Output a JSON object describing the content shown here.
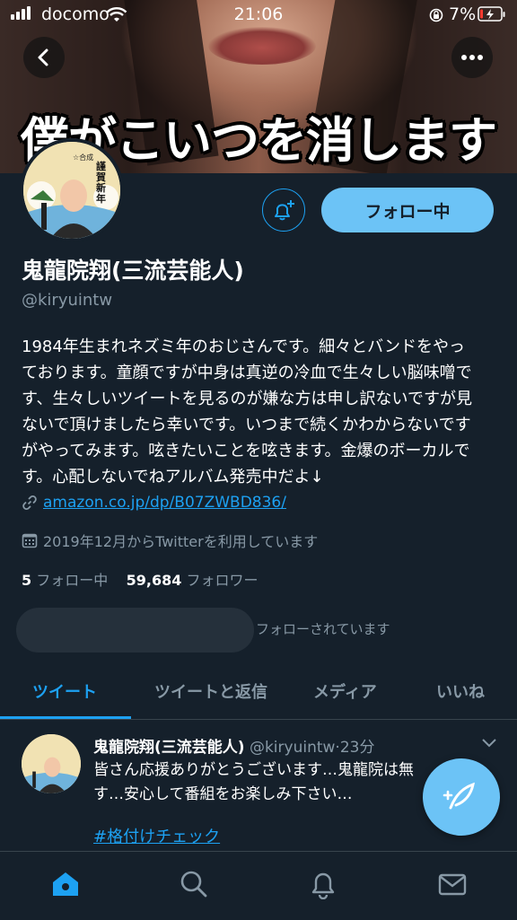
{
  "status_bar": {
    "carrier": "docomo",
    "time": "21:06",
    "battery": "7%"
  },
  "banner": {
    "caption": "僕がこいつを消します"
  },
  "avatar_badge": {
    "top": "☆合成",
    "main": "謹賀新年"
  },
  "profile": {
    "follow_button": "フォロー中",
    "display_name": "鬼龍院翔(三流芸能人)",
    "handle": "@kiryuintw",
    "bio": "1984年生まれネズミ年のおじさんです。細々とバンドをやっ\nております。童顔ですが中身は真逆の冷血で生々しい脳味噌で\nす、生々しいツイートを見るのが嫌な方は申し訳ないですが見\nないで頂けましたら幸いです。いつまで続くかわからないです\nがやってみます。呟きたいことを呟きます。金爆のボーカルで\nす。心配しないでねアルバム発売中だよ↓",
    "link": "amazon.co.jp/dp/B07ZWBD836/",
    "joined": "2019年12月からTwitterを利用しています",
    "following_count": "5",
    "following_label": "フォロー中",
    "followers_count": "59,684",
    "followers_label": "フォロワー",
    "followed_by": "フォローされています"
  },
  "tabs": [
    {
      "label": "ツイート",
      "active": true
    },
    {
      "label": "ツイートと返信",
      "active": false
    },
    {
      "label": "メディア",
      "active": false
    },
    {
      "label": "いいね",
      "active": false
    }
  ],
  "tweet": {
    "name": "鬼龍院翔(三流芸能人)",
    "handle": "@kiryuintw",
    "time": "23分",
    "text": "皆さん応援ありがとうございます…鬼龍院は無\nす…安心して番組をお楽しみ下さい…",
    "hashtag": "#格付けチェック"
  },
  "icons": {
    "back": "back-arrow-icon",
    "more": "more-dots-icon",
    "notify": "bell-plus-icon",
    "link": "link-icon",
    "calendar": "calendar-icon",
    "caret": "chevron-down-icon",
    "compose": "compose-feather-icon",
    "home": "home-icon",
    "search": "search-icon",
    "notifications": "bell-icon",
    "messages": "mail-icon"
  },
  "colors": {
    "background": "#15202b",
    "accent": "#1da1f2",
    "secondary_text": "#8899a6"
  }
}
